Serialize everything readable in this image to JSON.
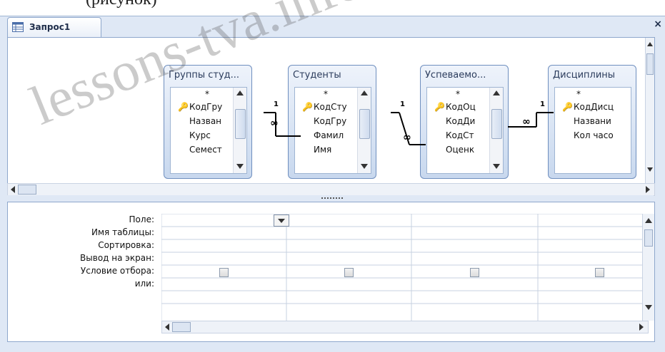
{
  "top_caption": "(рисунок)",
  "tab": {
    "label": "Запрос1",
    "close": "×"
  },
  "tables": [
    {
      "title": "Группы студ...",
      "fields": [
        "*",
        "КодГру",
        "Назван",
        "Курс",
        "Семест"
      ],
      "key_index": 1
    },
    {
      "title": "Студенты",
      "fields": [
        "*",
        "КодСту",
        "КодГру",
        "Фамил",
        "Имя"
      ],
      "key_index": 1
    },
    {
      "title": "Успеваемо...",
      "fields": [
        "*",
        "КодОц",
        "КодДи",
        "КодСт",
        "Оценк"
      ],
      "key_index": 1
    },
    {
      "title": "Дисциплины",
      "fields": [
        "*",
        "КодДисц",
        "Названи",
        "Кол часо"
      ],
      "key_index": 1
    }
  ],
  "relationship_labels": {
    "one": "1",
    "many": "∞"
  },
  "grid_rows": [
    "Поле:",
    "Имя таблицы:",
    "Сортировка:",
    "Вывод на экран:",
    "Условие отбора:",
    "или:"
  ],
  "watermark": "lessons-tva.info",
  "colors": {
    "frame": "#dfe8f5",
    "border": "#8ea7cc",
    "table_bg": "#c8d8ee"
  }
}
